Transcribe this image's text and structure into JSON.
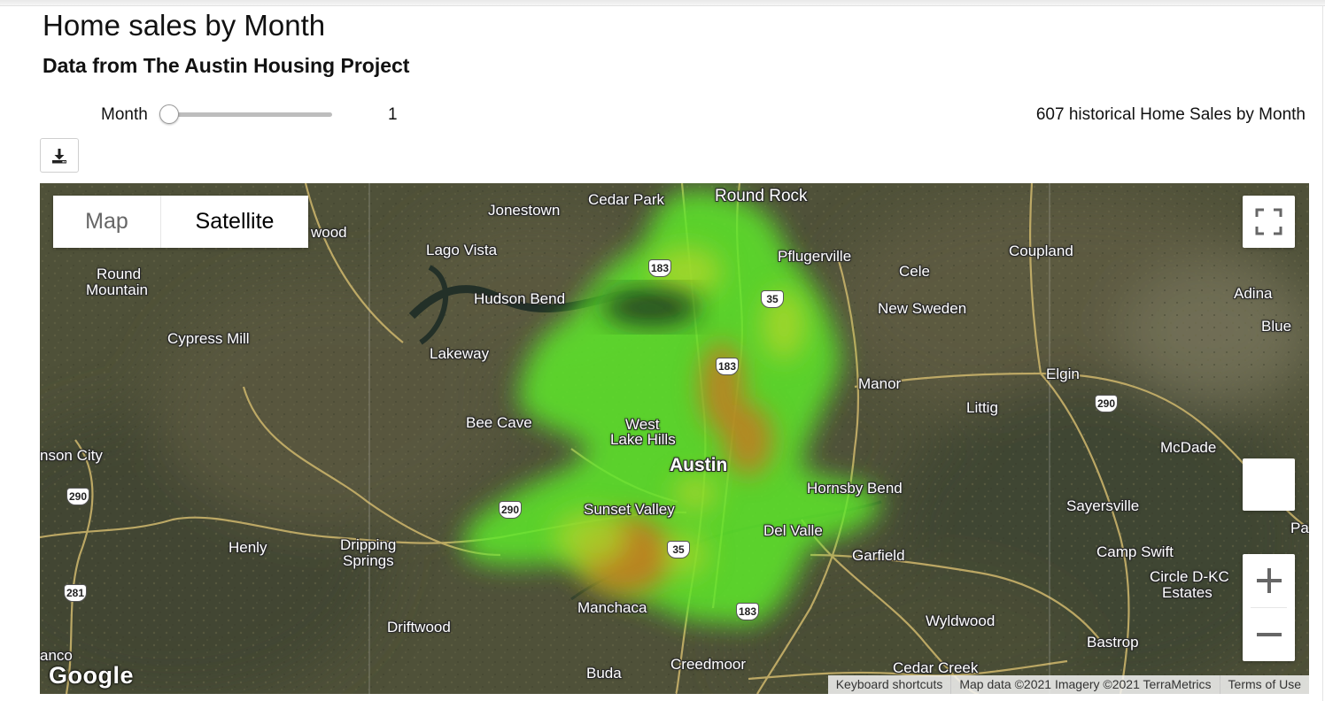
{
  "header": {
    "title": "Home sales by Month",
    "subtitle": "Data from The Austin Housing Project"
  },
  "controls": {
    "slider_label": "Month",
    "slider_value": "1",
    "slider_fraction": 0,
    "summary_text": "607 historical Home Sales by Month",
    "download_icon": "download-icon"
  },
  "map": {
    "type_buttons": {
      "map": "Map",
      "satellite": "Satellite",
      "selected": "Satellite"
    },
    "google_logo": "Google",
    "attribution": {
      "shortcuts": "Keyboard shortcuts",
      "data": "Map data ©2021 Imagery ©2021 TerraMetrics",
      "terms": "Terms of Use"
    },
    "places": {
      "cedar_park": "Cedar Park",
      "round_rock": "Round Rock",
      "jonestown": "Jonestown",
      "wood": "wood",
      "lago_vista": "Lago Vista",
      "pflugerville": "Pflugerville",
      "coupland": "Coupland",
      "cele": "Cele",
      "round_mountain_1": "Round",
      "round_mountain_2": "Mountain",
      "hudson_bend": "Hudson Bend",
      "adina": "Adina",
      "new_sweden": "New Sweden",
      "blue": "Blue",
      "cypress_mill": "Cypress Mill",
      "lakeway": "Lakeway",
      "manor": "Manor",
      "elgin": "Elgin",
      "littig": "Littig",
      "bee_cave": "Bee Cave",
      "west_lake_hills_1": "West",
      "west_lake_hills_2": "Lake Hills",
      "mcdade": "McDade",
      "johnson_city": "nson City",
      "austin": "Austin",
      "hornsby_bend": "Hornsby Bend",
      "sunset_valley": "Sunset Valley",
      "sayersville": "Sayersville",
      "henly": "Henly",
      "dripping_springs_1": "Dripping",
      "dripping_springs_2": "Springs",
      "del_valle": "Del Valle",
      "garfield": "Garfield",
      "camp_swift": "Camp Swift",
      "pa": "Pa",
      "circle_dkc_1": "Circle D-KC",
      "circle_dkc_2": "Estates",
      "manchaca": "Manchaca",
      "driftwood": "Driftwood",
      "wyldwood": "Wyldwood",
      "bastrop": "Bastrop",
      "anco": "anco",
      "buda": "Buda",
      "creedmoor": "Creedmoor",
      "cedar_creek": "Cedar Creek"
    },
    "shields": {
      "us183_north": "183",
      "i35_north": "35",
      "us183_mid": "183",
      "us290_east": "290",
      "us290_west": "290",
      "us290_center": "290",
      "i35_south": "35",
      "us183_south": "183",
      "us281": "281"
    },
    "colors": {
      "heat_low": "#5ee82a",
      "heat_mid": "#a7d62a",
      "heat_high": "#c9751e"
    }
  }
}
